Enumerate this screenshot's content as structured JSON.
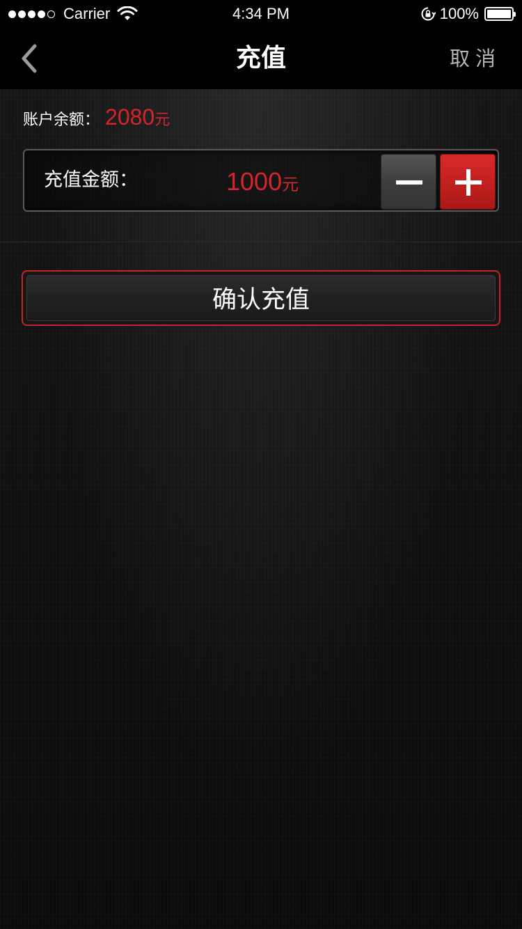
{
  "status_bar": {
    "carrier": "Carrier",
    "time": "4:34 PM",
    "battery_percent": "100%",
    "signal_bars_filled": 4,
    "signal_bars_total": 5,
    "battery_level": 1.0
  },
  "nav": {
    "title": "充值",
    "cancel_label": "取消",
    "back_icon": "chevron-left-icon"
  },
  "balance": {
    "label": "账户余额",
    "separator": "：",
    "value": "2080",
    "unit": "元"
  },
  "amount": {
    "label": "充值金额：",
    "value": "1000",
    "unit": "元",
    "decrease_icon": "minus-icon",
    "increase_icon": "plus-icon"
  },
  "confirm": {
    "label": "确认充值"
  },
  "colors": {
    "accent_red": "#d3262b",
    "background": "#0f0f0f",
    "nav_background": "#000000",
    "cancel_text": "#b5b5b5"
  }
}
